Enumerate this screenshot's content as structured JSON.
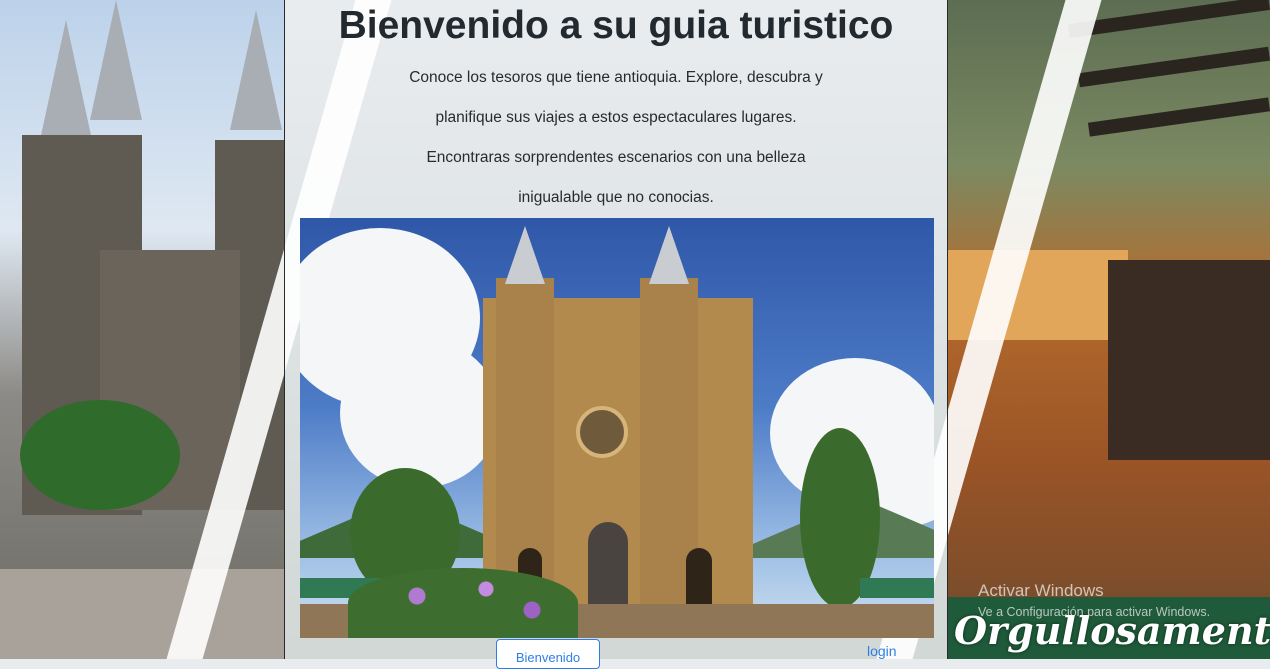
{
  "header": {
    "title": "Bienvenido a su guia turistico",
    "intro_lines": [
      "Conoce los tesoros que tiene antioquia. Explore, descubra y",
      "planifique sus viajes a estos espectaculares lugares.",
      "Encontraras sorprendentes escenarios con una belleza",
      "inigualable que no conocias."
    ]
  },
  "nav": {
    "button_label": "Bienvenido",
    "login_label": "login"
  },
  "background": {
    "right_banner_text": "Orgullosamente"
  },
  "watermark": {
    "title": "Activar Windows",
    "subtitle": "Ve a Configuración para activar Windows."
  },
  "colors": {
    "title_text": "#222a30",
    "link": "#2f7ee8",
    "banner_green": "#1f5a3a"
  },
  "icons": {
    "hero_image": "church-photo"
  }
}
